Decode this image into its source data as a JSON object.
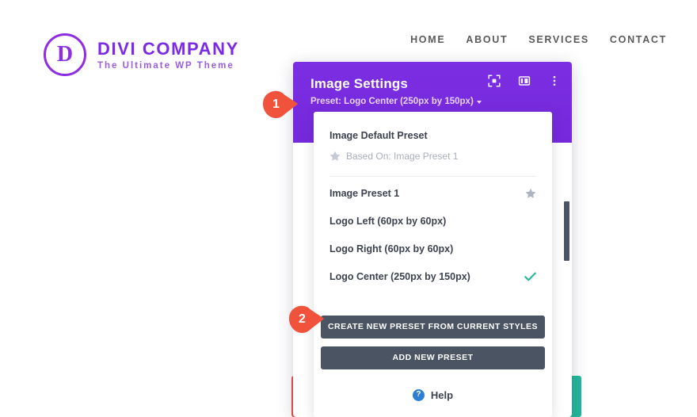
{
  "site": {
    "brand": {
      "mark_letter": "D",
      "title": "DIVI COMPANY",
      "subtitle": "The Ultimate WP Theme"
    },
    "nav": [
      {
        "label": "HOME"
      },
      {
        "label": "ABOUT"
      },
      {
        "label": "SERVICES"
      },
      {
        "label": "CONTACT"
      }
    ]
  },
  "modal": {
    "title": "Image Settings",
    "preset_line": "Preset: Logo Center (250px by 150px)",
    "header_icons": [
      {
        "name": "expand-icon"
      },
      {
        "name": "layout-columns-icon"
      },
      {
        "name": "more-options-icon"
      }
    ]
  },
  "dropdown": {
    "default_preset": {
      "title": "Image Default Preset",
      "based_on": "Based On: Image Preset 1"
    },
    "items": [
      {
        "label": "Image Preset 1",
        "marker": "star"
      },
      {
        "label": "Logo Left (60px by 60px)",
        "marker": "none"
      },
      {
        "label": "Logo Right (60px by 60px)",
        "marker": "none"
      },
      {
        "label": "Logo Center (250px by 150px)",
        "marker": "check"
      }
    ],
    "buttons": {
      "create_from_current": "CREATE NEW PRESET FROM CURRENT STYLES",
      "add_new": "ADD NEW PRESET"
    },
    "help": {
      "badge": "?",
      "label": "Help"
    }
  },
  "callouts": [
    {
      "number": "1"
    },
    {
      "number": "2"
    }
  ],
  "colors": {
    "brand_purple": "#7c2ae8",
    "modal_header": "#7a2ce0",
    "button_slate": "#4b5463",
    "check_teal": "#25b79b",
    "callout_red": "#f0523c",
    "help_blue": "#2d7fd3",
    "block_red": "#ef4b4b",
    "block_teal": "#25b79b"
  }
}
